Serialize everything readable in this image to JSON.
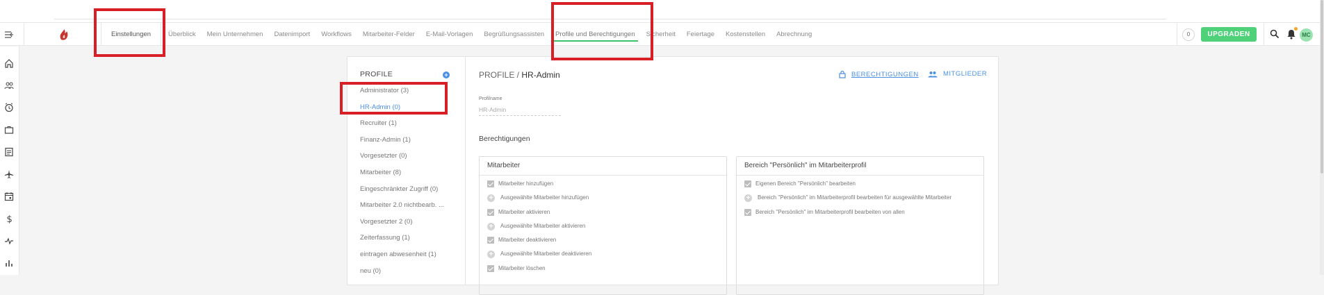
{
  "header": {
    "nav": [
      {
        "label": "Einstellungen"
      },
      {
        "label": "Überblick"
      },
      {
        "label": "Mein Unternehmen"
      },
      {
        "label": "Datenimport"
      },
      {
        "label": "Workflows"
      },
      {
        "label": "Mitarbeiter-Felder"
      },
      {
        "label": "E-Mail-Vorlagen"
      },
      {
        "label": "Begrüßungsassisten"
      },
      {
        "label": "Profile und Berechtigungen"
      },
      {
        "label": "Sicherheit"
      },
      {
        "label": "Feiertage"
      },
      {
        "label": "Kostenstellen"
      },
      {
        "label": "Abrechnung"
      }
    ],
    "counter": "0",
    "upgrade_label": "UPGRADEN",
    "avatar_initials": "MC",
    "accent_color": "#3cc36a"
  },
  "sidebar_icons": [
    "home-icon",
    "team-icon",
    "clock-icon",
    "briefcase-icon",
    "document-icon",
    "plane-icon",
    "calendar-icon",
    "dollar-icon",
    "activity-icon",
    "bar-chart-icon"
  ],
  "profiles": {
    "title": "PROFILE",
    "items": [
      "Administrator (3)",
      "HR-Admin (0)",
      "Recruiter (1)",
      "Finanz-Admin (1)",
      "Vorgesetzter (0)",
      "Mitarbeiter (8)",
      "Eingeschränkter Zugriff (0)",
      "Mitarbeiter 2.0 nichtbearb. ...",
      "Vorgesetzter 2 (0)",
      "Zeiterfassung (1)",
      "eintragen abwesenheit (1)",
      "neu (0)"
    ],
    "selected_index": 1
  },
  "main": {
    "heading_prefix": "PROFILE /",
    "heading_name": "HR-Admin",
    "tab_permissions": "BERECHTIGUNGEN",
    "tab_members": "MITGLIEDER",
    "field_label": "Profilname",
    "field_value": "HR-Admin",
    "section_title": "Berechtigungen",
    "box_left": {
      "title": "Mitarbeiter",
      "rows": [
        {
          "type": "check",
          "text": "Mitarbeiter hinzufügen"
        },
        {
          "type": "plus",
          "text": "Ausgewählte Mitarbeiter hinzufügen"
        },
        {
          "type": "check",
          "text": "Mitarbeiter aktivieren"
        },
        {
          "type": "plus",
          "text": "Ausgewählte Mitarbeiter aktivieren"
        },
        {
          "type": "check",
          "text": "Mitarbeiter deaktivieren"
        },
        {
          "type": "plus",
          "text": "Ausgewählte Mitarbeiter deaktivieren"
        },
        {
          "type": "check",
          "text": "Mitarbeiter löschen"
        }
      ]
    },
    "box_right": {
      "title": "Bereich \"Persönlich\" im Mitarbeiterprofil",
      "rows": [
        {
          "type": "check",
          "text": "Eigenen Bereich \"Persönlich\" bearbeiten"
        },
        {
          "type": "plus",
          "text": "Bereich \"Persönlich\" im Mitarbeiterprofil bearbeiten für ausgewählte Mitarbeiter"
        },
        {
          "type": "check",
          "text": "Bereich \"Persönlich\" im Mitarbeiterprofil bearbeiten von allen"
        }
      ]
    }
  }
}
